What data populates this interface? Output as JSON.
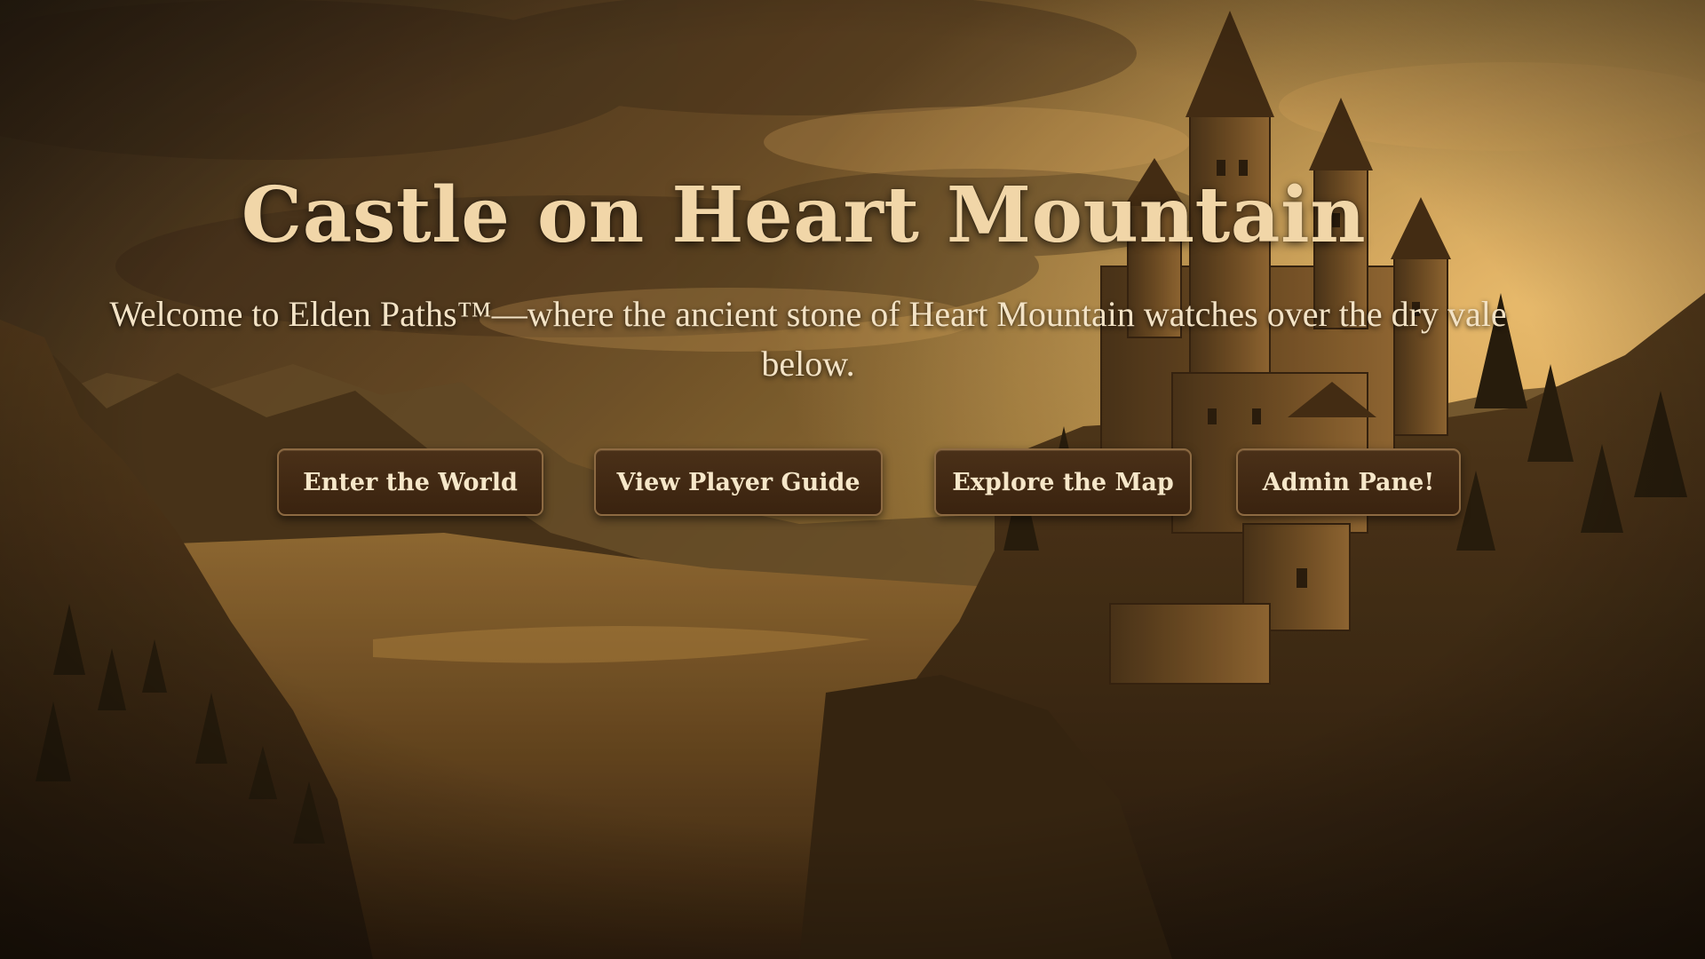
{
  "hero": {
    "title": "Castle on Heart Mountain",
    "subtitle": "Welcome to Elden Paths™—where the ancient stone of Heart Mountain watches over the dry vale below."
  },
  "actions": [
    {
      "label": "Enter the World"
    },
    {
      "label": "View Player Guide"
    },
    {
      "label": "Explore the Map"
    },
    {
      "label": "Admin Pane!"
    }
  ],
  "theme": {
    "title_color": "#f1d6a8",
    "button_bg": "#3f2814",
    "button_border": "#8d6a42",
    "sky_glow": "#d9a449"
  }
}
